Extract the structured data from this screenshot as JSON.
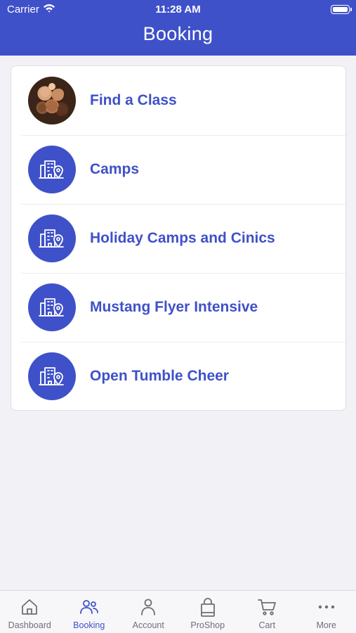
{
  "status_bar": {
    "carrier": "Carrier",
    "time": "11:28 AM"
  },
  "header": {
    "title": "Booking"
  },
  "items": [
    {
      "label": "Find a Class",
      "icon": "group-photo"
    },
    {
      "label": "Camps",
      "icon": "building-location-icon"
    },
    {
      "label": "Holiday Camps and Cinics",
      "icon": "building-location-icon"
    },
    {
      "label": "Mustang Flyer Intensive",
      "icon": "building-location-icon"
    },
    {
      "label": "Open Tumble Cheer",
      "icon": "building-location-icon"
    }
  ],
  "tabbar": {
    "active": "Booking",
    "tabs": [
      {
        "label": "Dashboard",
        "icon": "home-icon"
      },
      {
        "label": "Booking",
        "icon": "people-icon"
      },
      {
        "label": "Account",
        "icon": "person-icon"
      },
      {
        "label": "ProShop",
        "icon": "bag-icon"
      },
      {
        "label": "Cart",
        "icon": "cart-icon"
      },
      {
        "label": "More",
        "icon": "more-icon"
      }
    ]
  },
  "colors": {
    "accent": "#3f51c9",
    "background": "#f2f2f6",
    "tab_inactive": "#6e6e76"
  }
}
